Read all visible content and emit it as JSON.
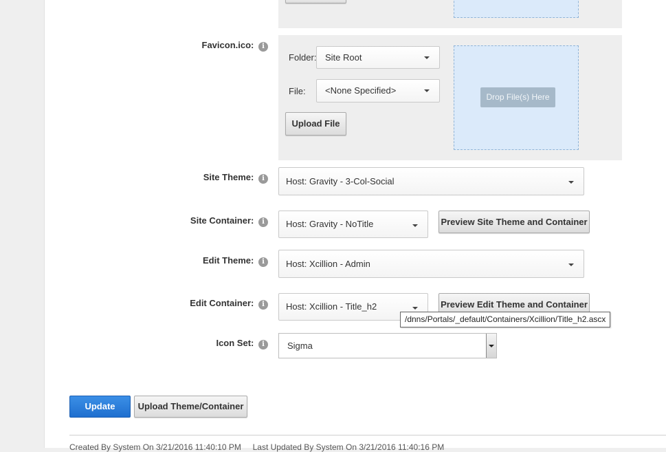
{
  "favicon": {
    "label": "Favicon.ico:",
    "folder_label": "Folder:",
    "folder_value": "Site Root",
    "file_label": "File:",
    "file_value": "<None Specified>",
    "upload_label": "Upload File",
    "drop_label": "Drop File(s) Here"
  },
  "site_theme": {
    "label": "Site Theme:",
    "value": "Host: Gravity - 3-Col-Social"
  },
  "site_container": {
    "label": "Site Container:",
    "value": "Host: Gravity - NoTitle",
    "preview_label": "Preview Site Theme and Container"
  },
  "edit_theme": {
    "label": "Edit Theme:",
    "value": "Host: Xcillion - Admin"
  },
  "edit_container": {
    "label": "Edit Container:",
    "value": "Host: Xcillion - Title_h2",
    "preview_label": "Preview Edit Theme and Container",
    "tooltip": "/dnns/Portals/_default/Containers/Xcillion/Title_h2.ascx"
  },
  "icon_set": {
    "label": "Icon Set:",
    "value": "Sigma"
  },
  "actions": {
    "update_label": "Update",
    "upload_theme_label": "Upload Theme/Container"
  },
  "footer": {
    "text": "Created By System On 3/21/2016 11:40:10 PM     Last Updated By System On 3/21/2016 11:40:16 PM"
  },
  "colors": {
    "primary": "#2f7fd9",
    "drop_zone": "#dbeafa",
    "panel": "#eeeeee"
  }
}
